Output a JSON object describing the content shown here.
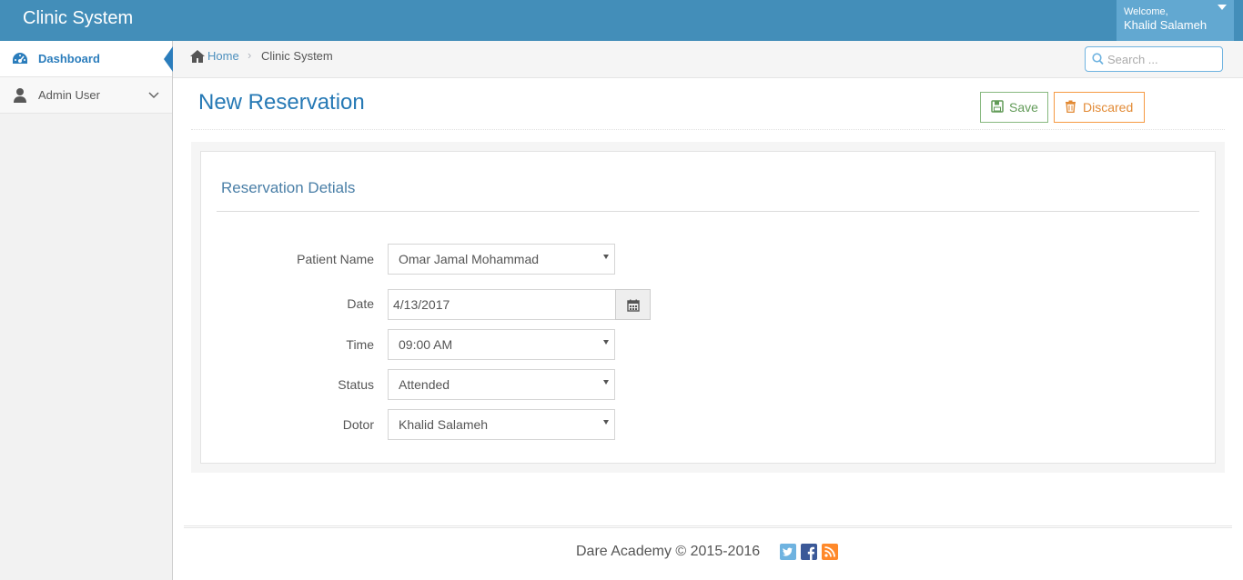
{
  "app": {
    "brand": "Clinic System"
  },
  "user": {
    "welcome": "Welcome,",
    "name": "Khalid Salameh"
  },
  "sidebar": {
    "items": [
      {
        "label": "Dashboard",
        "icon": "dashboard-icon",
        "active": true
      },
      {
        "label": "Admin User",
        "icon": "user-icon",
        "active": false
      }
    ]
  },
  "breadcrumb": {
    "home": "Home",
    "current": "Clinic System"
  },
  "search": {
    "placeholder": "Search ..."
  },
  "page": {
    "title": "New Reservation"
  },
  "actions": {
    "save_label": "Save",
    "discard_label": "Discared"
  },
  "panel": {
    "title": "Reservation Detials"
  },
  "form": {
    "patient": {
      "label": "Patient Name",
      "value": "Omar Jamal Mohammad"
    },
    "date": {
      "label": "Date",
      "value": "4/13/2017"
    },
    "time": {
      "label": "Time",
      "value": "09:00 AM"
    },
    "status": {
      "label": "Status",
      "value": "Attended"
    },
    "doctor": {
      "label": "Dotor",
      "value": "Khalid Salameh"
    }
  },
  "footer": {
    "text": "Dare Academy © 2015-2016"
  },
  "colors": {
    "navbar": "#438eb9",
    "user_box": "#62a8d1",
    "accent": "#2679b5",
    "save": "#629b58",
    "discard": "#e28a35"
  }
}
